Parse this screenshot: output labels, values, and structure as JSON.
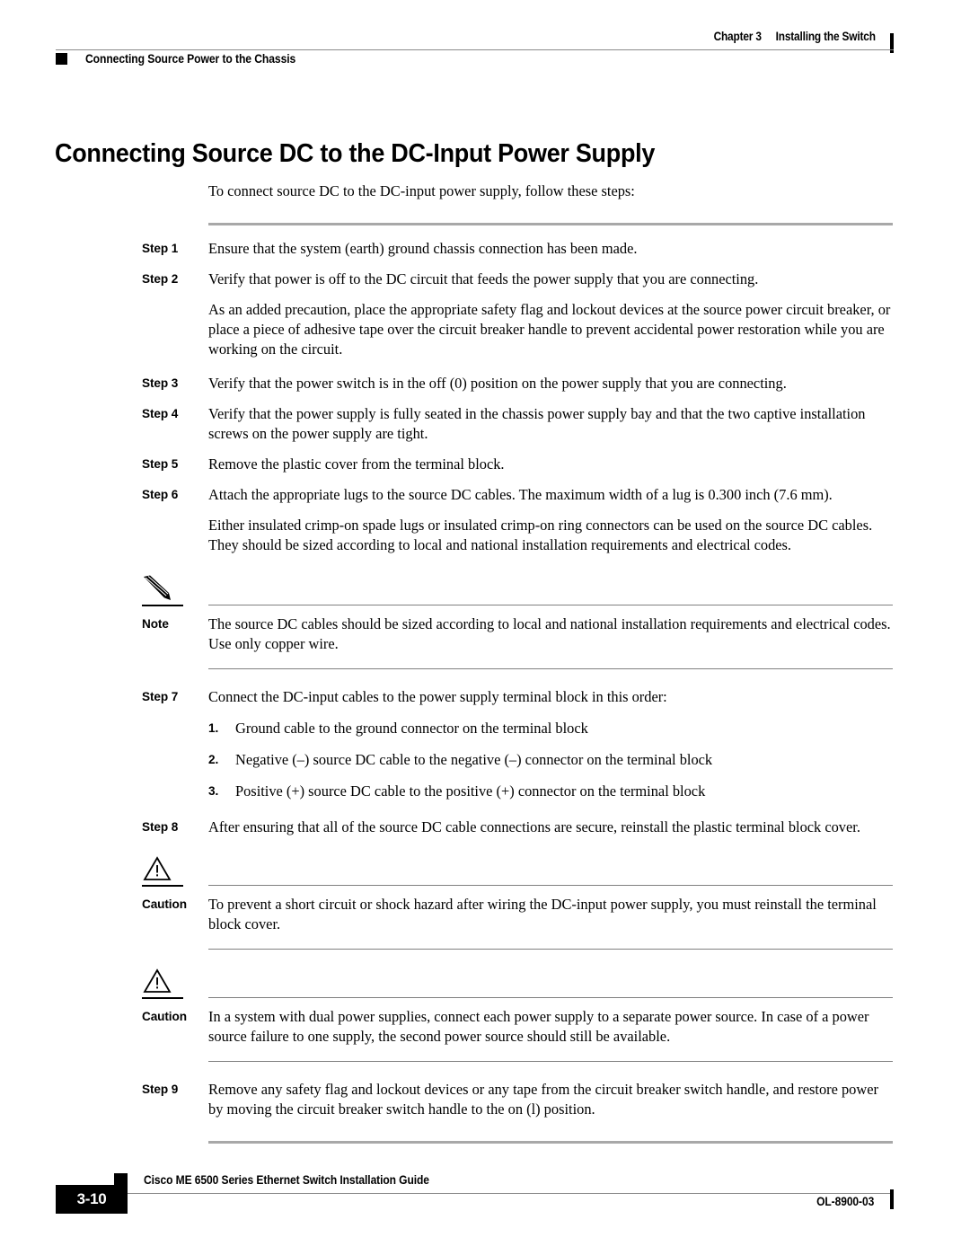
{
  "header": {
    "chapter": "Chapter 3",
    "chapter_title": "Installing the Switch",
    "section": "Connecting Source Power to the Chassis"
  },
  "title": "Connecting Source DC to the DC-Input Power Supply",
  "intro": "To connect source DC to the DC-input power supply, follow these steps:",
  "steps": [
    {
      "label": "Step 1",
      "text": "Ensure that the system (earth) ground chassis connection has been made."
    },
    {
      "label": "Step 2",
      "text": "Verify that power is off to the DC circuit that feeds the power supply that you are connecting."
    },
    {
      "label": "Step 3",
      "text": "Verify that the power switch is in the off (0) position on the power supply that you are connecting."
    },
    {
      "label": "Step 4",
      "text": "Verify that the power supply is fully seated in the chassis power supply bay and that the two captive installation screws on the power supply are tight."
    },
    {
      "label": "Step 5",
      "text": "Remove the plastic cover from the terminal block."
    },
    {
      "label": "Step 6",
      "text": "Attach the appropriate lugs to the source DC cables. The maximum width of a lug is 0.300 inch (7.6 mm)."
    },
    {
      "label": "Step 7",
      "text": "Connect the DC-input cables to the power supply terminal block in this order:"
    },
    {
      "label": "Step 8",
      "text": "After ensuring that all of the source DC cable connections are secure, reinstall the plastic terminal block cover."
    },
    {
      "label": "Step 9",
      "text": "Remove any safety flag and lockout devices or any tape from the circuit breaker switch handle, and restore power by moving the circuit breaker switch handle to the on (l) position."
    }
  ],
  "paragraphs": {
    "after_step2": "As an added precaution, place the appropriate safety flag and lockout devices at the source power circuit breaker, or place a piece of adhesive tape over the circuit breaker handle to prevent accidental power restoration while you are working on the circuit.",
    "after_step6": "Either insulated crimp-on spade lugs or insulated crimp-on ring connectors can be used on the source DC cables. They should be sized according to local and national installation requirements and electrical codes."
  },
  "note": {
    "label": "Note",
    "icon": "pencil-icon",
    "text": "The source DC cables should be sized according to local and national installation requirements and electrical codes. Use only copper wire."
  },
  "substeps": [
    {
      "num": "1.",
      "text": "Ground cable to the ground connector on the terminal block"
    },
    {
      "num": "2.",
      "text": "Negative (–) source DC cable to the negative (–) connector on the terminal block"
    },
    {
      "num": "3.",
      "text": "Positive (+) source DC cable to the positive (+) connector on the terminal block"
    }
  ],
  "cautions": [
    {
      "label": "Caution",
      "icon": "warning-triangle-icon",
      "text": "To prevent a short circuit or shock hazard after wiring the DC-input power supply, you must reinstall the terminal block cover."
    },
    {
      "label": "Caution",
      "icon": "warning-triangle-icon",
      "text": "In a system with dual power supplies, connect each power supply to a separate power source. In case of a power source failure to one supply, the second power source should still be available."
    }
  ],
  "footer": {
    "guide_title": "Cisco ME 6500 Series Ethernet Switch Installation Guide",
    "page_number": "3-10",
    "doc_id": "OL-8900-03"
  },
  "colors": {
    "text": "#000000",
    "rule_gray": "#a8a8a8",
    "rule_thin": "#808080",
    "page_bg": "#ffffff"
  }
}
